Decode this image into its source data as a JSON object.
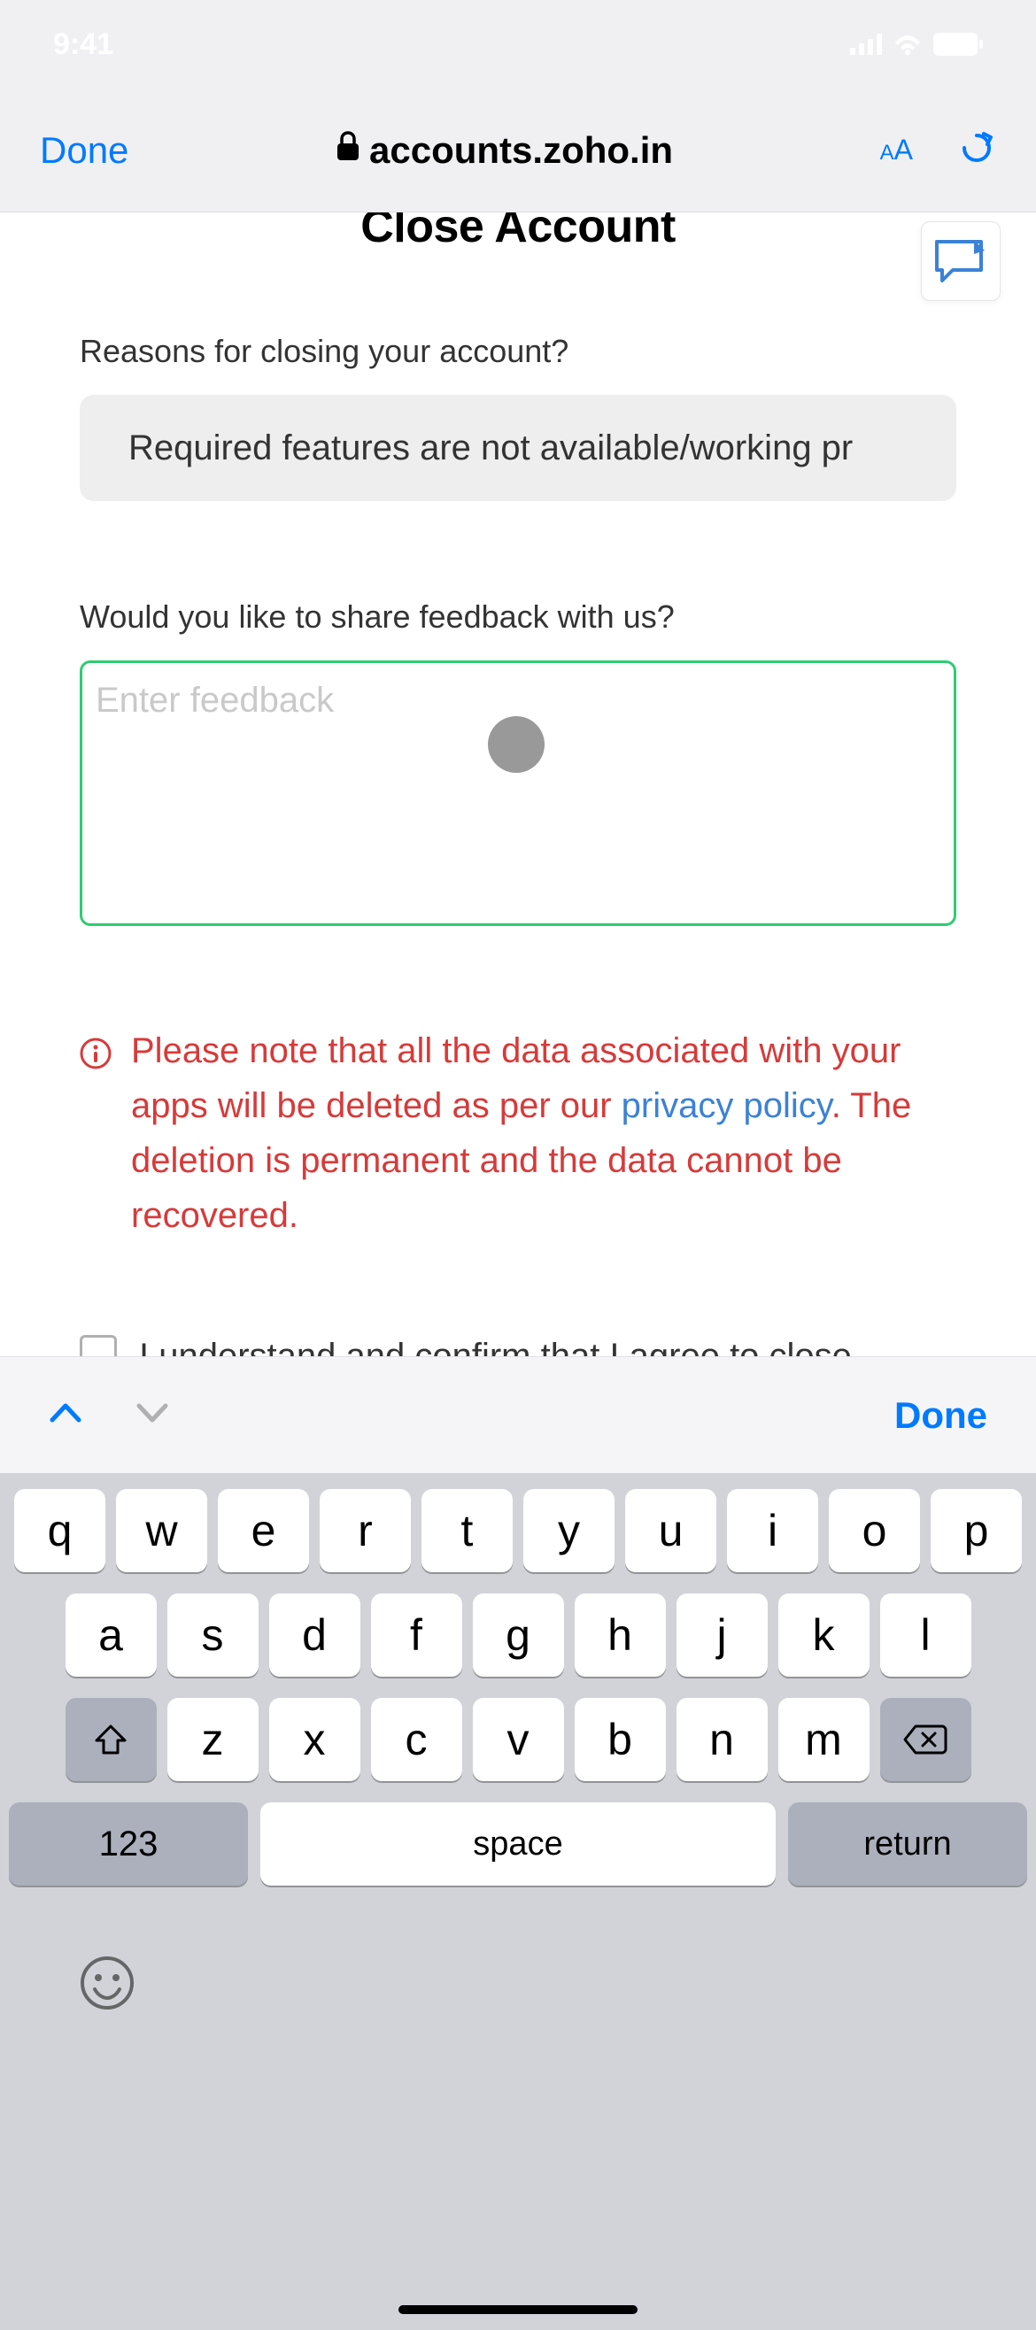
{
  "status_bar": {
    "time": "9:41"
  },
  "browser": {
    "done_label": "Done",
    "url": "accounts.zoho.in",
    "aa_label": "A"
  },
  "page": {
    "title": "Close Account",
    "reason_label": "Reasons for closing your account?",
    "reason_value": "Required features are not available/working pr",
    "feedback_label": "Would you like to share feedback with us?",
    "feedback_placeholder": "Enter feedback",
    "warning_text_1": "Please note that all the data associated with your apps will be deleted as per our ",
    "warning_link": "privacy policy",
    "warning_text_2": ". The deletion is permanent and the data cannot be recovered.",
    "checkbox_label": "I understand and confirm that I agree to close"
  },
  "keyboard_accessory": {
    "done_label": "Done"
  },
  "keyboard": {
    "row1": [
      "q",
      "w",
      "e",
      "r",
      "t",
      "y",
      "u",
      "i",
      "o",
      "p"
    ],
    "row2": [
      "a",
      "s",
      "d",
      "f",
      "g",
      "h",
      "j",
      "k",
      "l"
    ],
    "row3": [
      "z",
      "x",
      "c",
      "v",
      "b",
      "n",
      "m"
    ],
    "numbers_label": "123",
    "space_label": "space",
    "return_label": "return"
  }
}
